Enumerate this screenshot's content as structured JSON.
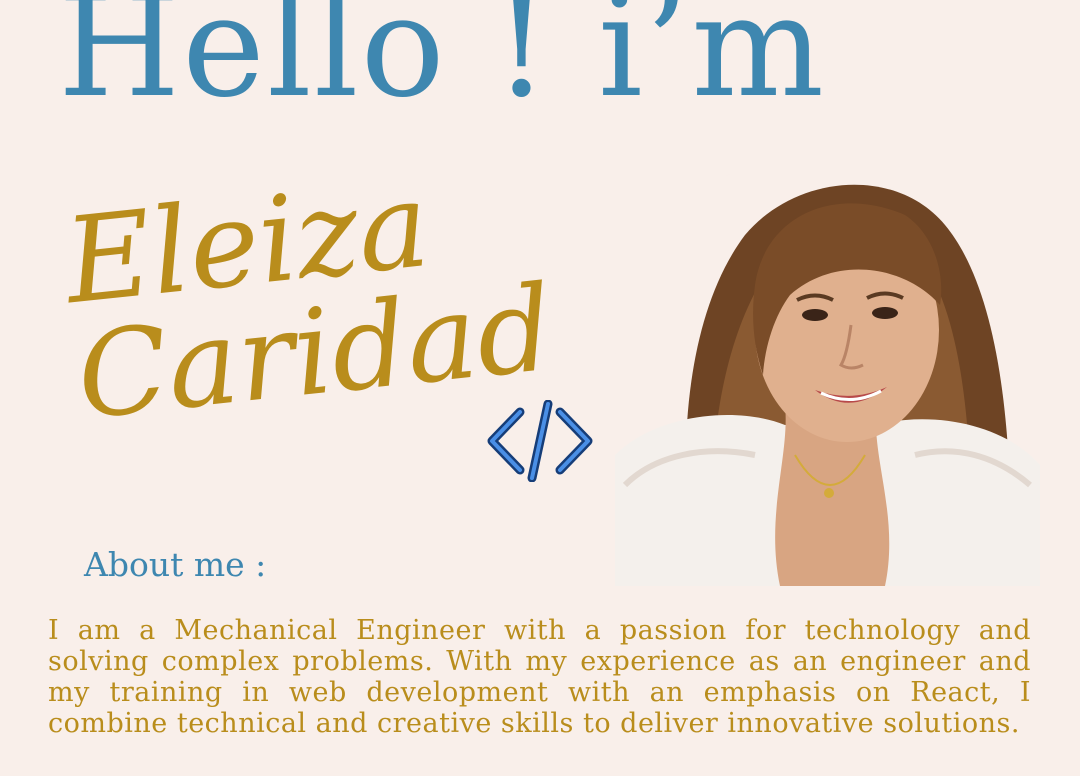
{
  "colors": {
    "background": "#f9efea",
    "accent_blue": "#3e87b0",
    "accent_gold": "#b98d1c",
    "icon_blue": "#2f6fd0"
  },
  "hero": {
    "greeting": "Hello ! i’m",
    "first_name": "Eleiza",
    "last_name": "Caridad",
    "icon": "code-brackets-icon"
  },
  "about": {
    "heading": "About me :",
    "text": "I am a Mechanical Engineer with a passion for technology and solving complex problems. With my experience as an engineer and my training in web development with an emphasis on React, I combine technical and creative skills to deliver innovative solutions."
  }
}
